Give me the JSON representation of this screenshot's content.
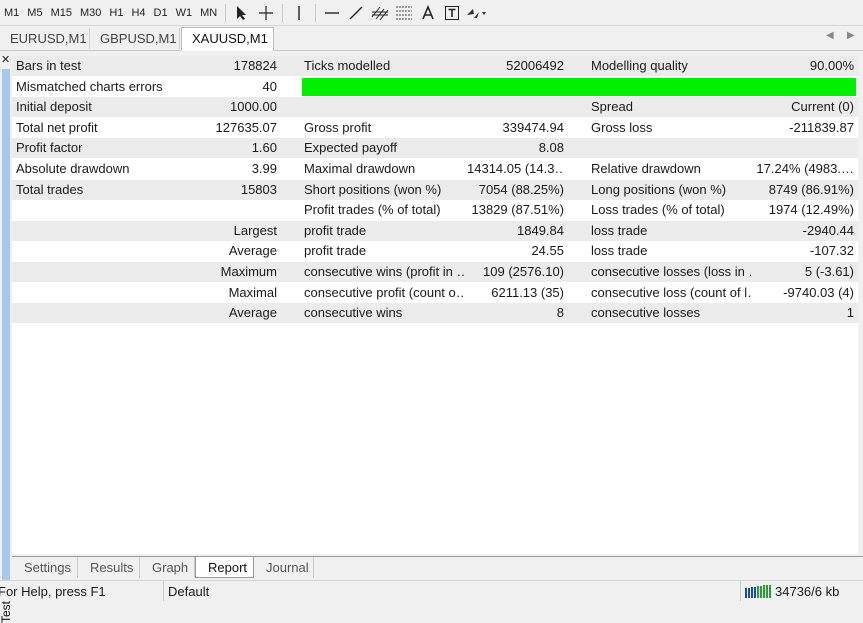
{
  "toolbar": {
    "timeframes": [
      "M1",
      "M5",
      "M15",
      "M30",
      "H1",
      "H4",
      "D1",
      "W1",
      "MN"
    ]
  },
  "chart_tabs": [
    "EURUSD,M1",
    "GBPUSD,M1",
    "XAUUSD,M1"
  ],
  "active_chart_tab": "XAUUSD,M1",
  "side_label": "Tester",
  "report": {
    "rows": [
      {
        "l1": "Bars in test",
        "v1": "178824",
        "l2": "Ticks modelled",
        "v2": "52006492",
        "l3": "Modelling quality",
        "v3": "90.00%"
      },
      {
        "l1": "Mismatched charts errors",
        "v1": "40",
        "quality_fraction": 0.9
      },
      {
        "l1": "Initial deposit",
        "v1": "1000.00",
        "l2": "",
        "v2": "",
        "l3": "Spread",
        "v3": "Current (0)"
      },
      {
        "l1": "Total net profit",
        "v1": "127635.07",
        "l2": "Gross profit",
        "v2": "339474.94",
        "l3": "Gross loss",
        "v3": "-211839.87"
      },
      {
        "l1": "Profit factor",
        "v1": "1.60",
        "l2": "Expected payoff",
        "v2": "8.08",
        "l3": "",
        "v3": ""
      },
      {
        "l1": "Absolute drawdown",
        "v1": "3.99",
        "l2": "Maximal drawdown",
        "v2": "14314.05 (14.3…",
        "l3": "Relative drawdown",
        "v3": "17.24% (4983.…"
      },
      {
        "l1": "Total trades",
        "v1": "15803",
        "l2": "Short positions (won %)",
        "v2": "7054 (88.25%)",
        "l3": "Long positions (won %)",
        "v3": "8749 (86.91%)"
      },
      {
        "l1": "",
        "v1": "",
        "l2": "Profit trades (% of total)",
        "v2": "13829 (87.51%)",
        "l3": "Loss trades (% of total)",
        "v3": "1974 (12.49%)"
      },
      {
        "l1": "",
        "v1": "Largest",
        "l2": "profit trade",
        "v2": "1849.84",
        "l3": "loss trade",
        "v3": "-2940.44"
      },
      {
        "l1": "",
        "v1": "Average",
        "l2": "profit trade",
        "v2": "24.55",
        "l3": "loss trade",
        "v3": "-107.32"
      },
      {
        "l1": "",
        "v1": "Maximum",
        "l2": "consecutive wins (profit in …",
        "v2": "109 (2576.10)",
        "l3": "consecutive losses (loss in …",
        "v3": "5 (-3.61)"
      },
      {
        "l1": "",
        "v1": "Maximal",
        "l2": "consecutive profit (count o…",
        "v2": "6211.13 (35)",
        "l3": "consecutive loss (count of l…",
        "v3": "-9740.03 (4)"
      },
      {
        "l1": "",
        "v1": "Average",
        "l2": "consecutive wins",
        "v2": "8",
        "l3": "consecutive losses",
        "v3": "1"
      }
    ]
  },
  "bottom_tabs": [
    "Settings",
    "Results",
    "Graph",
    "Report",
    "Journal"
  ],
  "active_bottom_tab": "Report",
  "status": {
    "help": "For Help, press F1",
    "profile": "Default",
    "traffic": "34736/6 kb"
  },
  "colors": {
    "quality_bar": "#00f000",
    "row_shade": "#ebebeb",
    "side_accent": "#a9c7ef"
  }
}
